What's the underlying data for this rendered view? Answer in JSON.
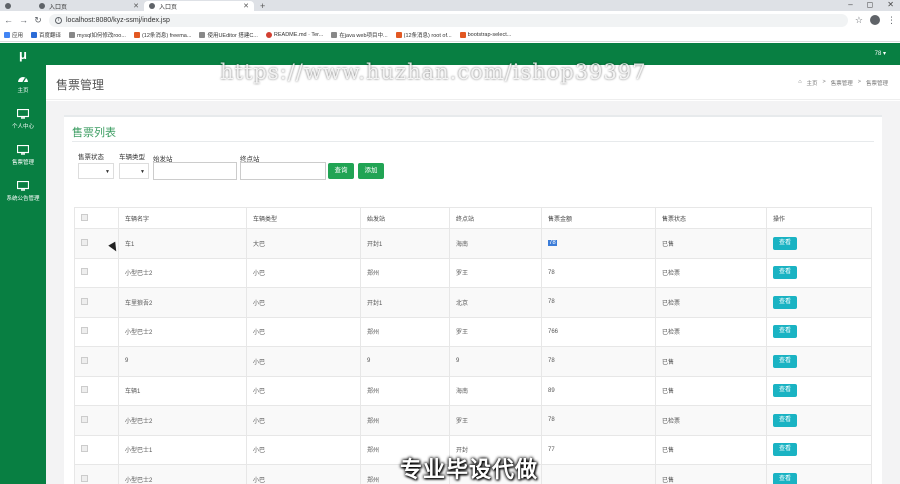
{
  "browser": {
    "tabs": [
      {
        "label": ""
      },
      {
        "label": "入口页"
      },
      {
        "label": "入口页"
      }
    ],
    "url": "localhost:8080/kyz-ssmj/index.jsp",
    "bookmarks": [
      {
        "label": "应用",
        "color": "#4285f4"
      },
      {
        "label": "百度翻译",
        "color": "#2a6bd6"
      },
      {
        "label": "mysql如何修改roo...",
        "color": "#888888"
      },
      {
        "label": "(12条消息) freema...",
        "color": "#e25822"
      },
      {
        "label": "使用UEditor 搭建C...",
        "color": "#888888"
      },
      {
        "label": "README.md · Ter...",
        "color": "#d23f31"
      },
      {
        "label": "在java web项目中...",
        "color": "#888888"
      },
      {
        "label": "(12条消息) root of...",
        "color": "#e25822"
      },
      {
        "label": "bootstrap-select...",
        "color": "#e25822"
      }
    ]
  },
  "sidebar": {
    "logo": "μ",
    "items": [
      {
        "label": "主页",
        "icon": "dashboard-icon"
      },
      {
        "label": "个人中心",
        "icon": "monitor-icon"
      },
      {
        "label": "售票管理",
        "icon": "monitor-icon"
      },
      {
        "label": "系统公告管理",
        "icon": "monitor-icon"
      }
    ]
  },
  "topbar": {
    "user": "78 ▾"
  },
  "header": {
    "title": "售票管理",
    "breadcrumbs": [
      "主页",
      "售票管理",
      "售票管理"
    ]
  },
  "panel": {
    "title": "售票列表",
    "filters": {
      "status_label": "售票状态",
      "vehicle_type_label": "车辆类型",
      "start_label": "始发站",
      "end_label": "终点站",
      "query_button": "查询",
      "add_button": "添加"
    },
    "columns": [
      "",
      "车辆名字",
      "车辆类型",
      "始发站",
      "终点站",
      "售票金额",
      "售票状态",
      "操作"
    ],
    "rows": [
      [
        "车1",
        "大巴",
        "开封1",
        "海南",
        "78",
        "已售"
      ],
      [
        "小型巴士2",
        "小巴",
        "郑州",
        "罗王",
        "78",
        "已检票"
      ],
      [
        "车里狼吾2",
        "小巴",
        "开封1",
        "北京",
        "78",
        "已检票"
      ],
      [
        "小型巴士2",
        "小巴",
        "郑州",
        "罗王",
        "766",
        "已检票"
      ],
      [
        "9",
        "小巴",
        "9",
        "9",
        "78",
        "已售"
      ],
      [
        "车辆1",
        "小巴",
        "郑州",
        "海南",
        "89",
        "已售"
      ],
      [
        "小型巴士2",
        "小巴",
        "郑州",
        "罗王",
        "78",
        "已检票"
      ],
      [
        "小型巴士1",
        "小巴",
        "郑州",
        "开封",
        "77",
        "已售"
      ],
      [
        "小型巴士2",
        "小巴",
        "郑州",
        "",
        "",
        "已售"
      ]
    ],
    "action_label": "查看"
  },
  "overlay": {
    "watermark": "https://www.huzhan.com/ishop39397",
    "caption": "专业毕设代做"
  }
}
